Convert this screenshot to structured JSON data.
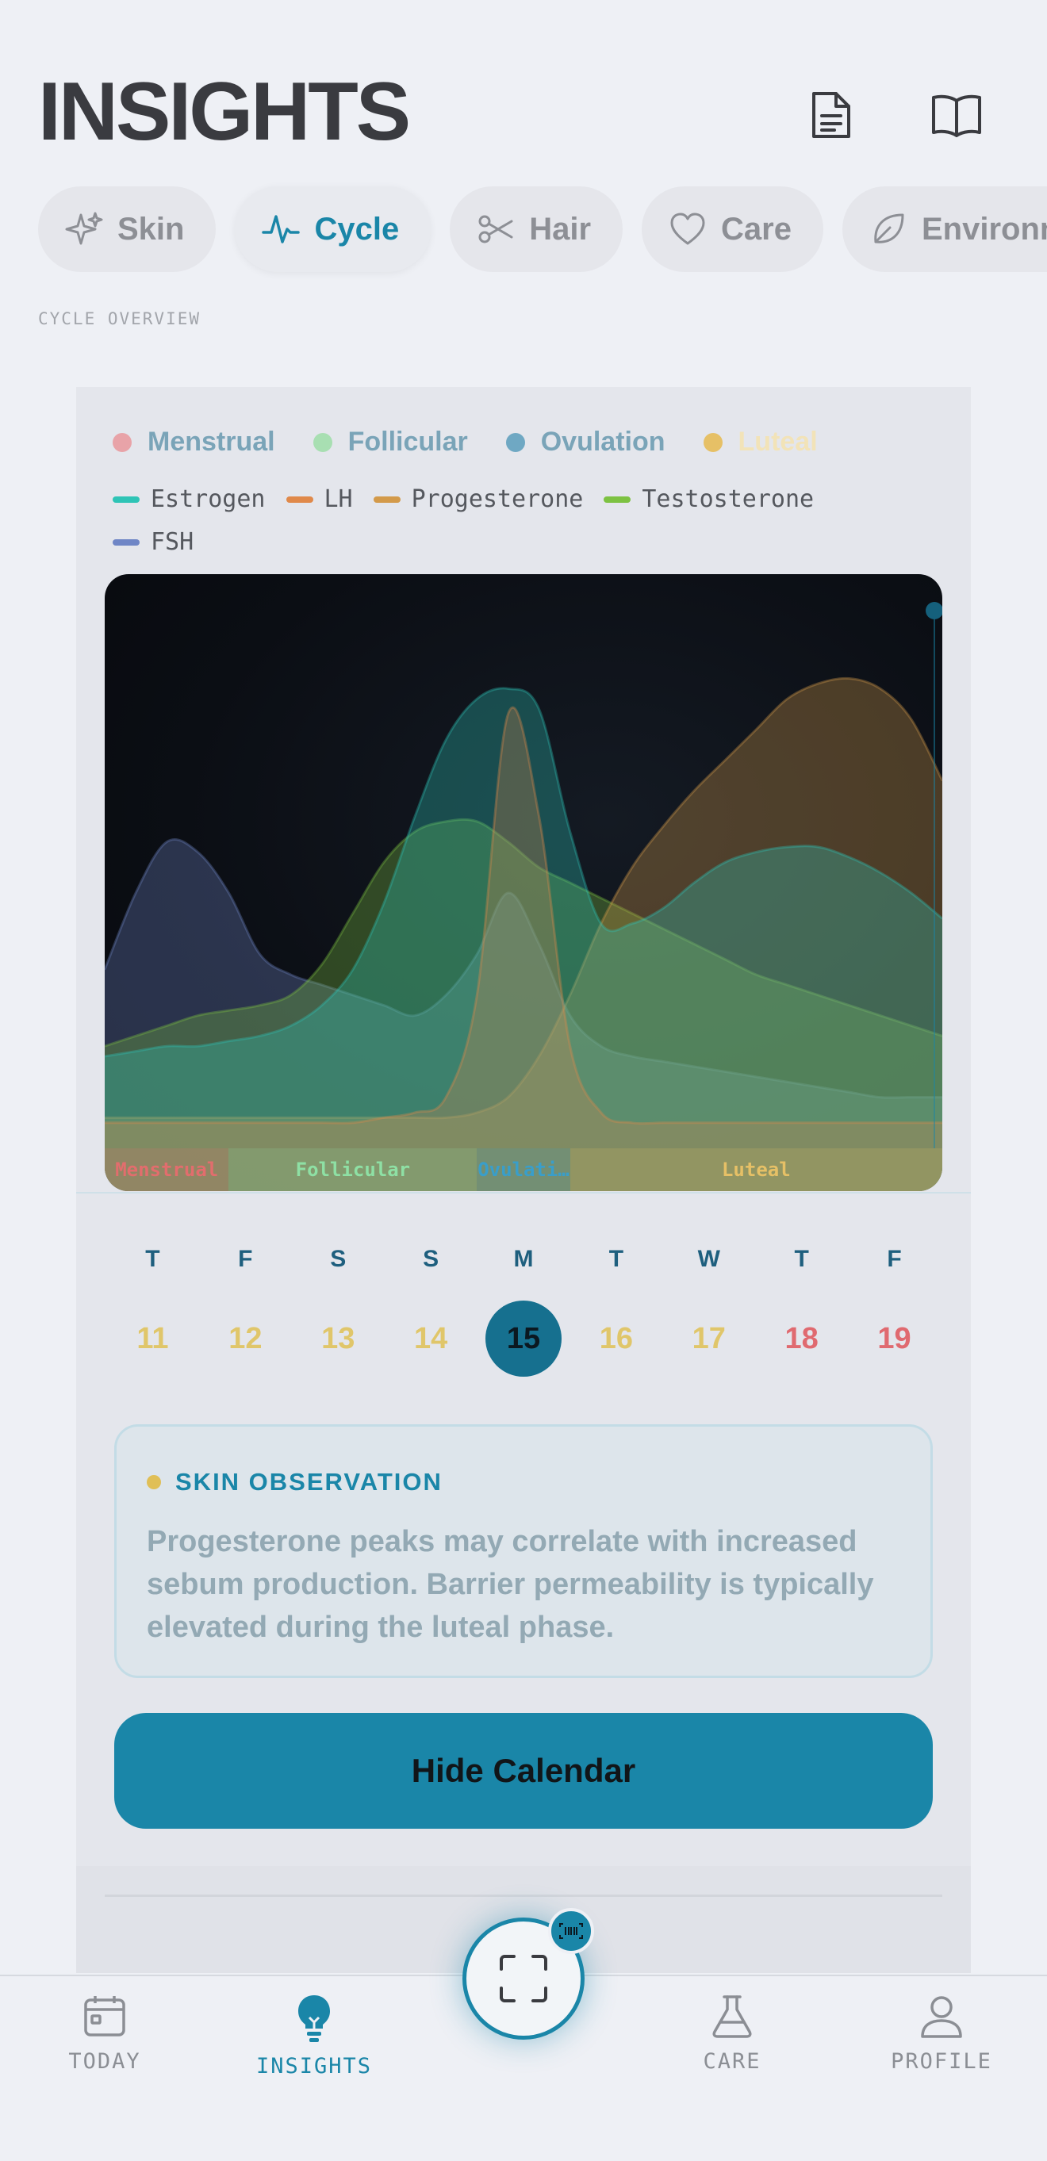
{
  "header": {
    "title": "INSIGHTS",
    "icons": [
      "document-icon",
      "book-icon"
    ]
  },
  "tabs": [
    {
      "label": "Skin",
      "icon": "sparkle-icon",
      "active": false
    },
    {
      "label": "Cycle",
      "icon": "pulse-icon",
      "active": true
    },
    {
      "label": "Hair",
      "icon": "scissors-icon",
      "active": false
    },
    {
      "label": "Care",
      "icon": "heart-icon",
      "active": false
    },
    {
      "label": "Environm",
      "icon": "leaf-icon",
      "active": false
    }
  ],
  "section_label": "CYCLE OVERVIEW",
  "phase_legend": [
    {
      "label": "Menstrual",
      "color": "#e8a3a8"
    },
    {
      "label": "Follicular",
      "color": "#a8dfb2"
    },
    {
      "label": "Ovulation",
      "color": "#6fa8c3"
    },
    {
      "label": "Luteal",
      "color": "#e6c066"
    }
  ],
  "hormone_legend": [
    {
      "label": "Estrogen",
      "color": "#2ec4b6"
    },
    {
      "label": "LH",
      "color": "#e0894a"
    },
    {
      "label": "Progesterone",
      "color": "#d39a4a"
    },
    {
      "label": "Testosterone",
      "color": "#7dc242"
    },
    {
      "label": "FSH",
      "color": "#6f86c6"
    }
  ],
  "chart_data": {
    "type": "area",
    "x": [
      1,
      2,
      3,
      4,
      5,
      6,
      7,
      8,
      9,
      10,
      11,
      12,
      13,
      14,
      15,
      16,
      17,
      18,
      19,
      20,
      21,
      22,
      23,
      24,
      25,
      26,
      27,
      28
    ],
    "ylim": [
      0,
      1
    ],
    "series": [
      {
        "name": "Estrogen",
        "color": "#2ec4b6",
        "values": [
          0.18,
          0.19,
          0.2,
          0.2,
          0.21,
          0.22,
          0.24,
          0.28,
          0.35,
          0.48,
          0.65,
          0.8,
          0.88,
          0.9,
          0.86,
          0.62,
          0.44,
          0.44,
          0.47,
          0.52,
          0.56,
          0.58,
          0.59,
          0.59,
          0.57,
          0.54,
          0.5,
          0.45
        ]
      },
      {
        "name": "LH",
        "color": "#e0894a",
        "values": [
          0.05,
          0.05,
          0.05,
          0.05,
          0.05,
          0.05,
          0.05,
          0.05,
          0.05,
          0.06,
          0.07,
          0.1,
          0.3,
          0.85,
          0.65,
          0.2,
          0.07,
          0.05,
          0.05,
          0.05,
          0.05,
          0.05,
          0.05,
          0.05,
          0.05,
          0.05,
          0.05,
          0.05
        ]
      },
      {
        "name": "Progesterone",
        "color": "#d39a4a",
        "values": [
          0.06,
          0.06,
          0.06,
          0.06,
          0.06,
          0.06,
          0.06,
          0.06,
          0.06,
          0.06,
          0.06,
          0.06,
          0.07,
          0.1,
          0.18,
          0.3,
          0.44,
          0.55,
          0.63,
          0.7,
          0.76,
          0.82,
          0.88,
          0.91,
          0.92,
          0.9,
          0.84,
          0.72
        ]
      },
      {
        "name": "Testosterone",
        "color": "#7dc242",
        "values": [
          0.2,
          0.22,
          0.24,
          0.26,
          0.27,
          0.28,
          0.3,
          0.36,
          0.46,
          0.56,
          0.62,
          0.64,
          0.64,
          0.6,
          0.55,
          0.52,
          0.49,
          0.46,
          0.43,
          0.4,
          0.37,
          0.34,
          0.32,
          0.3,
          0.28,
          0.26,
          0.24,
          0.22
        ]
      },
      {
        "name": "FSH",
        "color": "#6f86c6",
        "values": [
          0.35,
          0.5,
          0.6,
          0.58,
          0.5,
          0.38,
          0.34,
          0.32,
          0.3,
          0.28,
          0.26,
          0.3,
          0.38,
          0.5,
          0.4,
          0.26,
          0.2,
          0.18,
          0.17,
          0.16,
          0.15,
          0.14,
          0.13,
          0.12,
          0.11,
          0.1,
          0.1,
          0.1
        ]
      }
    ],
    "phases": [
      {
        "label": "Menstrual",
        "start": 1,
        "end": 5,
        "color": "#e26d6d"
      },
      {
        "label": "Follicular",
        "start": 5,
        "end": 13,
        "color": "#8ee0a4"
      },
      {
        "label": "Ovulation",
        "start": 13,
        "end": 16,
        "color": "#3a9ec9"
      },
      {
        "label": "Luteal",
        "start": 16,
        "end": 28,
        "color": "#e6c066"
      }
    ],
    "phase_band_labels": [
      "Menstrual",
      "Follicular",
      "Ovulati…",
      "Luteal"
    ],
    "current_day": 28
  },
  "calendar": {
    "days": [
      {
        "dow": "T",
        "num": "11",
        "color": "#e0c66a",
        "selected": false
      },
      {
        "dow": "F",
        "num": "12",
        "color": "#e0c66a",
        "selected": false
      },
      {
        "dow": "S",
        "num": "13",
        "color": "#e0c66a",
        "selected": false
      },
      {
        "dow": "S",
        "num": "14",
        "color": "#e0c66a",
        "selected": false
      },
      {
        "dow": "M",
        "num": "15",
        "color": "#0b1820",
        "selected": true
      },
      {
        "dow": "T",
        "num": "16",
        "color": "#e0c66a",
        "selected": false
      },
      {
        "dow": "W",
        "num": "17",
        "color": "#e0c66a",
        "selected": false
      },
      {
        "dow": "T",
        "num": "18",
        "color": "#e06a70",
        "selected": false
      },
      {
        "dow": "F",
        "num": "19",
        "color": "#e06a70",
        "selected": false
      }
    ]
  },
  "observation": {
    "heading": "SKIN OBSERVATION",
    "body": "Progesterone peaks may correlate with increased sebum production. Barrier permeability is typically elevated during the luteal phase."
  },
  "hide_calendar_button": "Hide Calendar",
  "bottom_nav": [
    {
      "label": "TODAY",
      "icon": "calendar-icon",
      "active": false
    },
    {
      "label": "INSIGHTS",
      "icon": "lightbulb-icon",
      "active": true
    },
    {
      "label": "CARE",
      "icon": "flask-icon",
      "active": false
    },
    {
      "label": "PROFILE",
      "icon": "user-icon",
      "active": false
    }
  ],
  "scan_button": {
    "icon": "scan-icon",
    "badge_icon": "barcode-icon"
  },
  "colors": {
    "accent": "#1a86a8",
    "background": "#eef0f5"
  }
}
